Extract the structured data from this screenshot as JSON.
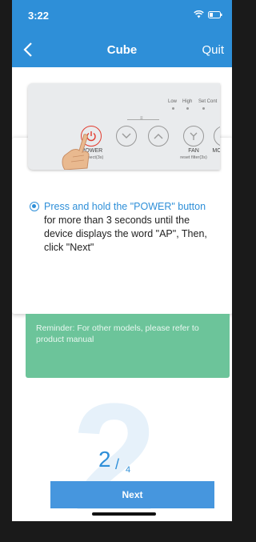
{
  "status": {
    "time": "3:22"
  },
  "nav": {
    "title": "Cube",
    "quit_label": "Quit"
  },
  "panel": {
    "power_label": "POWER",
    "power_sub": "connect(3s)",
    "fan_label": "FAN",
    "fan_sub": "reset filter(3s)",
    "mode_label": "MO",
    "low": "Low",
    "high": "High",
    "set": "Set Cont"
  },
  "instruction": {
    "highlight": "Press and hold the \"POWER\" button",
    "rest": "for more than 3 seconds until the device displays the word \"AP\", Then, click \"Next\""
  },
  "reminder": {
    "text": "Reminder: For other models, please refer to product manual"
  },
  "step": {
    "current": "2",
    "slash": "/",
    "total": "4",
    "watermark": "2"
  },
  "next_label": "Next",
  "colors": {
    "accent": "#2e8fd8",
    "reminder_bg": "#6cc49a"
  }
}
